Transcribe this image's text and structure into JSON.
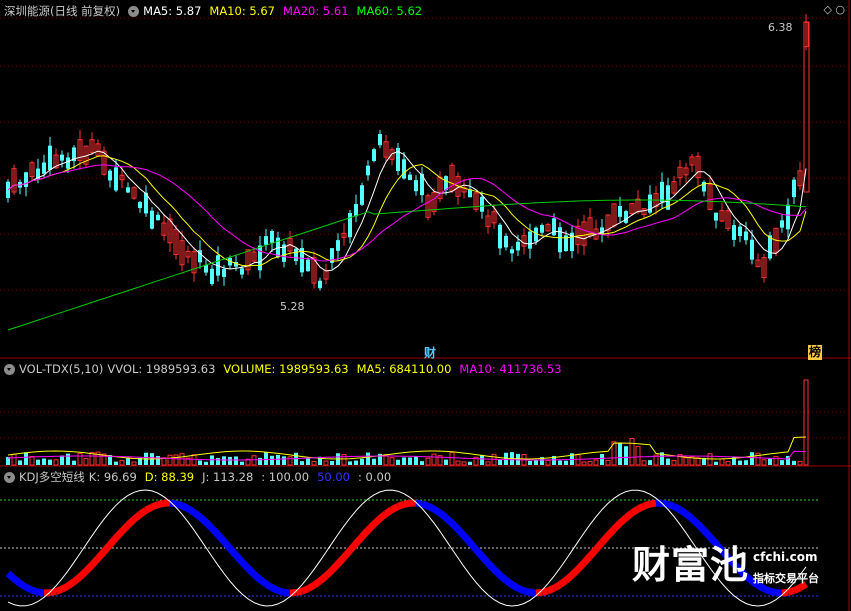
{
  "main_panel": {
    "title": "深圳能源(日线 前复权)",
    "ma_items": [
      {
        "label": "MA5: 5.87",
        "color": "#ffffff"
      },
      {
        "label": "MA10: 5.67",
        "color": "#ffff00"
      },
      {
        "label": "MA20: 5.61",
        "color": "#ff00ff"
      },
      {
        "label": "MA60: 5.62",
        "color": "#00ff00"
      }
    ],
    "high_label": "6.38",
    "low_label": "5.28",
    "marker_cai": "财",
    "marker_bang": "榜"
  },
  "vol_panel": {
    "title": "VOL-TDX(5,10)",
    "items": [
      {
        "label": "VVOL: 1989593.63",
        "color": "#c8c8c8"
      },
      {
        "label": "VOLUME: 1989593.63",
        "color": "#ffff00"
      },
      {
        "label": "MA5: 684110.00",
        "color": "#ffff00"
      },
      {
        "label": "MA10: 411736.53",
        "color": "#ff00ff"
      }
    ]
  },
  "kdj_panel": {
    "title": "KDJ多空短线",
    "items": [
      {
        "label": "K: 96.69",
        "color": "#c8c8c8"
      },
      {
        "label": "D: 88.39",
        "color": "#ffff00"
      },
      {
        "label": "J: 113.28",
        "color": "#c8c8c8"
      },
      {
        "label": ": 100.00",
        "color": "#c8c8c8"
      },
      {
        "label": "50.00",
        "color": "#3333ff"
      },
      {
        "label": ": 0.00",
        "color": "#c8c8c8"
      }
    ]
  },
  "watermark": {
    "big": "财富池",
    "url": "cfchi.com",
    "sub": "指标交易平台"
  },
  "colors": {
    "up": "#ff3232",
    "down": "#54ffff",
    "grid": "#7a0000",
    "k_up": "#ff0000",
    "k_down": "#0000ff"
  }
}
